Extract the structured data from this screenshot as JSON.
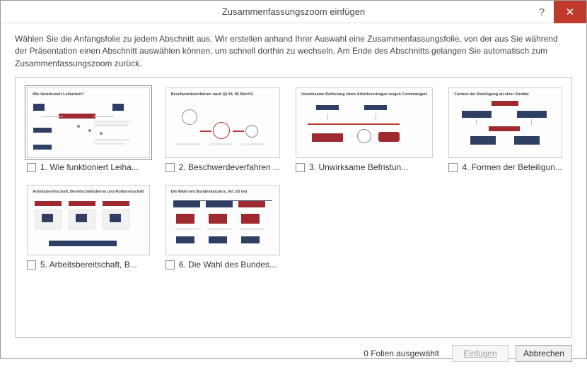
{
  "title": "Zusammenfassungszoom einfügen",
  "helpGlyph": "?",
  "closeGlyph": "✕",
  "intro": "Wählen Sie die Anfangsfolie zu jedem Abschnitt aus. Wir erstellen anhand Ihrer Auswahl eine Zusammenfassungsfolie, von der aus Sie während der Präsentation einen Abschnitt auswählen können, um schnell dorthin zu wechseln. Am Ende des Abschnitts gelangen Sie automatisch zum Zusammenfassungszoom zurück.",
  "slides": [
    {
      "caption": "1. Wie funktioniert Leiha...",
      "thumbTitle": "Wie funktioniert Leiharbeit?",
      "selected": true
    },
    {
      "caption": "2. Beschwerdeverfahren ...",
      "thumbTitle": "Beschwerdeverfahren nach §§ 84, 85 BetrVG",
      "selected": false
    },
    {
      "caption": "3. Unwirksame Befristun...",
      "thumbTitle": "Unwirksame Befristung eines Arbeitsvertrages wegen Formmangels",
      "selected": false
    },
    {
      "caption": "4. Formen der Beteiligun...",
      "thumbTitle": "Formen der Beteiligung an einer Straftat",
      "selected": false
    },
    {
      "caption": "5. Arbeitsbereitschaft, B...",
      "thumbTitle": "Arbeitsbereitschaft, Bereitschaftsdienst und Rufbereitschaft",
      "selected": false
    },
    {
      "caption": "6. Die Wahl des Bundes...",
      "thumbTitle": "Die Wahl des Bundeskanzlers, Art. 63 GG",
      "selected": false
    }
  ],
  "status": "0 Folien ausgewählt",
  "insertLabel": "Einfügen",
  "cancelLabel": "Abbrechen"
}
